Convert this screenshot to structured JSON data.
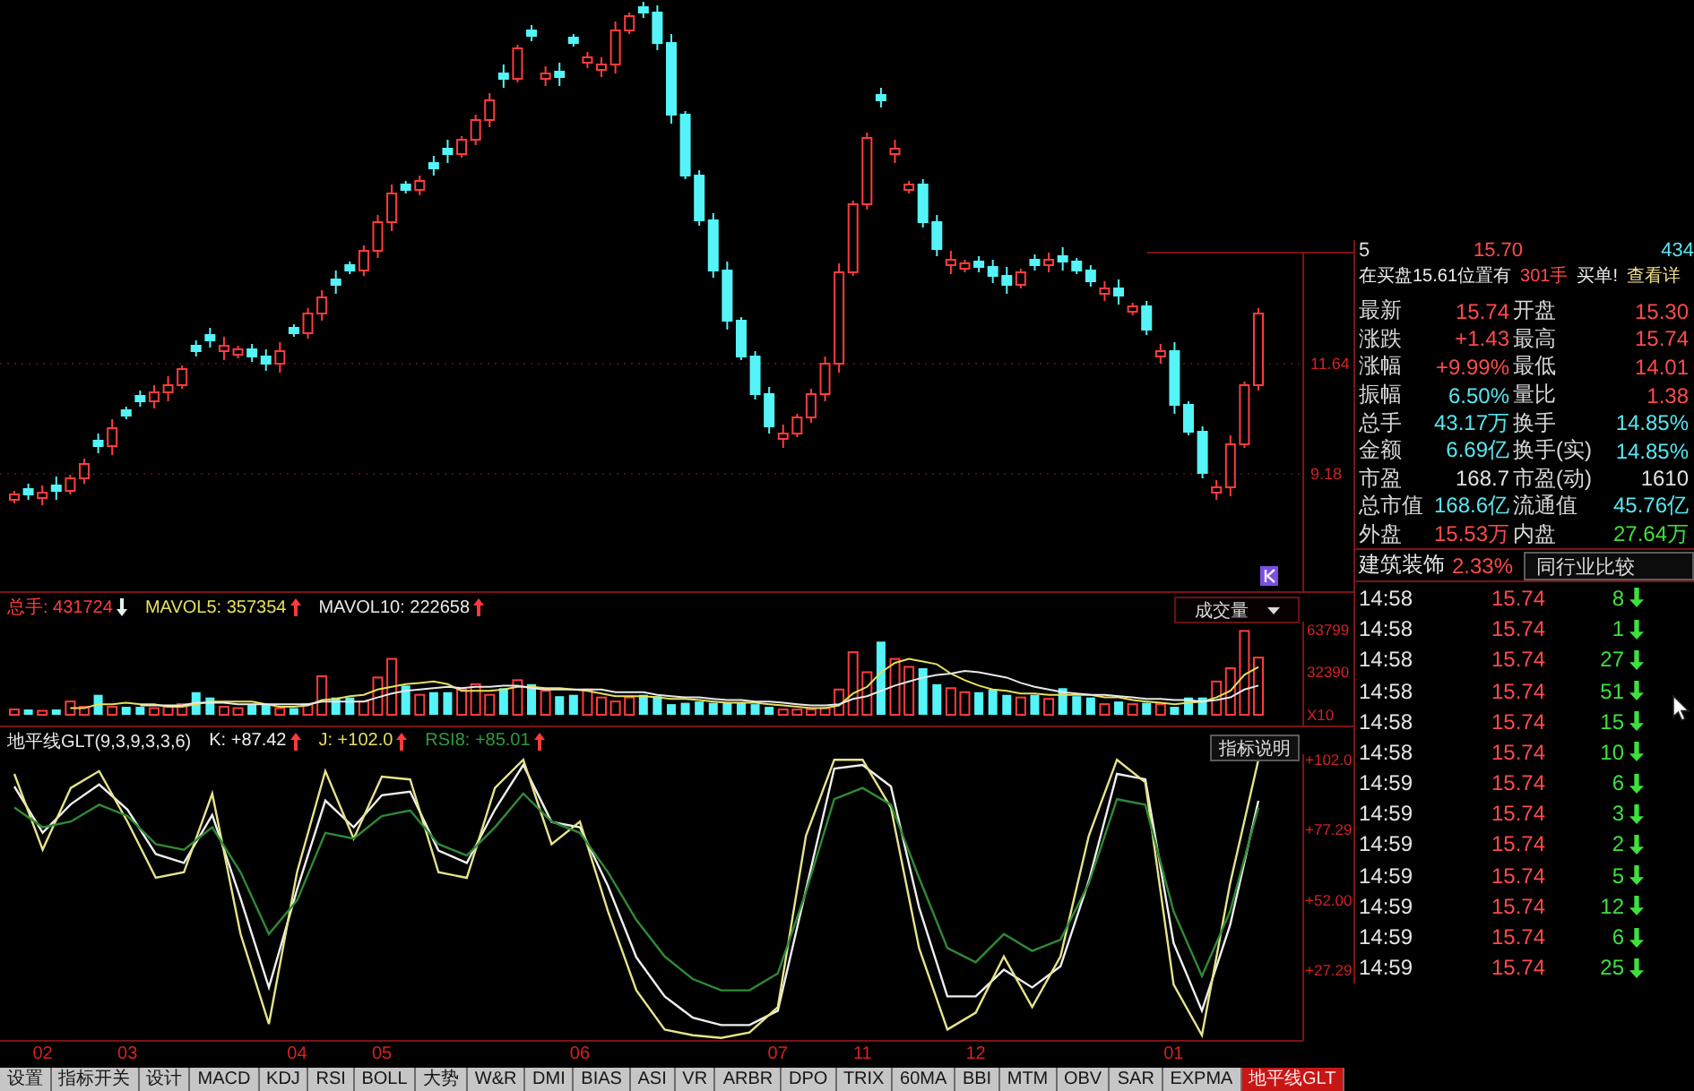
{
  "price_chart": {
    "chart_data": {
      "type": "candlestick",
      "ylim": [
        6.56,
        14.12
      ],
      "yticks": [
        {
          "value": 11.64,
          "label": "11.64"
        },
        {
          "value": 9.18,
          "label": "9.18"
        }
      ],
      "categories": [
        null,
        null,
        null,
        null,
        null,
        null,
        null,
        null,
        null,
        null,
        null,
        null,
        null,
        null,
        null,
        null,
        null,
        null,
        null,
        null,
        null,
        null,
        null,
        null,
        null,
        null,
        null,
        null,
        null,
        null,
        null,
        null,
        null,
        null,
        null,
        null,
        null,
        null,
        null,
        null,
        null,
        null,
        null,
        null,
        null,
        null,
        null,
        null,
        null,
        null,
        null,
        null,
        null,
        null,
        null,
        null,
        null,
        null,
        null,
        null,
        null,
        null,
        null,
        null,
        null,
        null,
        null,
        null,
        null,
        null,
        null,
        null,
        null,
        null,
        null,
        null,
        null,
        null,
        null,
        null,
        null,
        null,
        null,
        null,
        null,
        null,
        null,
        null,
        null,
        null
      ],
      "ohlc": [
        [
          8.6,
          8.8,
          8.52,
          8.72
        ],
        [
          8.84,
          8.96,
          8.6,
          8.72
        ],
        [
          8.64,
          8.92,
          8.48,
          8.76
        ],
        [
          8.92,
          9.12,
          8.6,
          8.8
        ],
        [
          8.8,
          9.16,
          8.72,
          9.08
        ],
        [
          9.08,
          9.52,
          8.96,
          9.4
        ],
        [
          9.92,
          10.08,
          9.64,
          9.8
        ],
        [
          9.8,
          10.4,
          9.6,
          10.2
        ],
        [
          10.6,
          10.68,
          10.4,
          10.48
        ],
        [
          10.92,
          11.04,
          10.68,
          10.8
        ],
        [
          10.8,
          11.16,
          10.64,
          11.0
        ],
        [
          11.0,
          11.36,
          10.8,
          11.16
        ],
        [
          11.16,
          11.6,
          11.08,
          11.52
        ],
        [
          12.04,
          12.16,
          11.8,
          11.92
        ],
        [
          12.28,
          12.44,
          12.0,
          12.16
        ],
        [
          11.92,
          12.24,
          11.72,
          12.04
        ],
        [
          11.84,
          12.04,
          11.76,
          11.96
        ],
        [
          11.96,
          12.08,
          11.68,
          11.8
        ],
        [
          11.8,
          11.96,
          11.48,
          11.64
        ],
        [
          11.64,
          12.12,
          11.44,
          11.92
        ],
        [
          12.44,
          12.52,
          12.24,
          12.32
        ],
        [
          12.32,
          12.88,
          12.2,
          12.76
        ],
        [
          12.76,
          13.28,
          12.6,
          13.12
        ],
        [
          13.52,
          13.72,
          13.2,
          13.4
        ],
        [
          13.84,
          13.92,
          13.64,
          13.72
        ],
        [
          13.72,
          14.28,
          13.6,
          14.16
        ],
        [
          14.16,
          14.96,
          14.0,
          14.8
        ],
        [
          14.8,
          15.64,
          14.6,
          15.44
        ],
        [
          15.64,
          15.72,
          15.44,
          15.52
        ],
        [
          15.52,
          15.84,
          15.4,
          15.72
        ],
        [
          16.12,
          16.28,
          15.84,
          16.0
        ],
        [
          16.44,
          16.64,
          16.12,
          16.32
        ],
        [
          16.32,
          16.72,
          16.24,
          16.64
        ],
        [
          16.64,
          17.2,
          16.52,
          17.08
        ],
        [
          17.08,
          17.68,
          16.92,
          17.52
        ],
        [
          18.12,
          18.32,
          17.8,
          18.0
        ],
        [
          18.0,
          18.76,
          17.92,
          18.68
        ],
        [
          19.08,
          19.2,
          18.84,
          18.96
        ],
        [
          18.0,
          18.28,
          17.84,
          18.12
        ],
        [
          18.16,
          18.36,
          17.84,
          18.04
        ],
        [
          18.92,
          19.0,
          18.72,
          18.8
        ],
        [
          18.36,
          18.6,
          18.24,
          18.48
        ],
        [
          18.2,
          18.48,
          18.04,
          18.32
        ],
        [
          18.32,
          19.28,
          18.12,
          19.08
        ],
        [
          19.08,
          19.48,
          19.0,
          19.4
        ],
        [
          19.6,
          19.72,
          19.36,
          19.48
        ],
        [
          19.48,
          19.64,
          18.64,
          18.8
        ],
        [
          18.8,
          19.0,
          17.0,
          17.2
        ],
        [
          17.2,
          17.28,
          15.76,
          15.84
        ],
        [
          15.84,
          15.96,
          14.72,
          14.84
        ],
        [
          14.84,
          15.0,
          13.56,
          13.72
        ],
        [
          13.72,
          13.92,
          12.4,
          12.6
        ],
        [
          12.6,
          12.68,
          11.72,
          11.8
        ],
        [
          11.8,
          11.92,
          10.84,
          10.96
        ],
        [
          10.96,
          11.12,
          10.08,
          10.24
        ],
        [
          9.96,
          10.28,
          9.76,
          10.08
        ],
        [
          10.08,
          10.52,
          10.0,
          10.44
        ],
        [
          10.44,
          11.08,
          10.32,
          10.96
        ],
        [
          10.96,
          11.8,
          10.8,
          11.64
        ],
        [
          11.64,
          13.88,
          11.44,
          13.68
        ],
        [
          13.68,
          15.28,
          13.6,
          15.2
        ],
        [
          15.2,
          16.8,
          15.08,
          16.68
        ],
        [
          17.64,
          17.8,
          17.36,
          17.52
        ],
        [
          16.32,
          16.64,
          16.12,
          16.44
        ],
        [
          15.52,
          15.72,
          15.44,
          15.64
        ],
        [
          15.64,
          15.76,
          14.68,
          14.8
        ],
        [
          14.8,
          14.96,
          14.04,
          14.2
        ],
        [
          13.84,
          14.16,
          13.64,
          13.96
        ],
        [
          13.76,
          13.96,
          13.68,
          13.88
        ],
        [
          13.92,
          14.04,
          13.68,
          13.8
        ],
        [
          13.8,
          13.96,
          13.44,
          13.6
        ],
        [
          13.6,
          13.8,
          13.2,
          13.4
        ],
        [
          13.4,
          13.76,
          13.32,
          13.68
        ],
        [
          13.96,
          14.08,
          13.72,
          13.84
        ],
        [
          13.84,
          14.12,
          13.68,
          13.96
        ],
        [
          14.04,
          14.24,
          13.72,
          13.92
        ],
        [
          13.92,
          14.0,
          13.64,
          13.72
        ],
        [
          13.72,
          13.84,
          13.36,
          13.48
        ],
        [
          13.2,
          13.48,
          13.04,
          13.32
        ],
        [
          13.32,
          13.52,
          12.96,
          13.16
        ],
        [
          12.8,
          13.0,
          12.72,
          12.92
        ],
        [
          12.92,
          13.04,
          12.28,
          12.4
        ],
        [
          11.8,
          12.08,
          11.64,
          11.92
        ],
        [
          11.92,
          12.12,
          10.52,
          10.72
        ],
        [
          10.72,
          10.8,
          10.04,
          10.12
        ],
        [
          10.12,
          10.24,
          9.08,
          9.2
        ],
        [
          8.76,
          9.04,
          8.6,
          8.88
        ],
        [
          8.88,
          10.04,
          8.68,
          9.84
        ],
        [
          9.84,
          11.24,
          9.76,
          11.16
        ],
        [
          11.16,
          12.88,
          11.04,
          12.76
        ]
      ]
    }
  },
  "volume_pane": {
    "header": [
      {
        "text": "总手: 431724",
        "color": "#ff3c3c",
        "rising": false
      },
      {
        "text": "MAVOL5: 357354",
        "color": "#e6e05a",
        "rising": true
      },
      {
        "text": "MAVOL10: 222658",
        "color": "#e8e8e8",
        "rising": true
      }
    ],
    "selector": "成交量",
    "chart_data": {
      "type": "bar",
      "stacked": true,
      "ylim": [
        0,
        70000
      ],
      "yticks": [
        {
          "value": 0,
          "label": "X10"
        },
        {
          "value": 32390,
          "label": "32390"
        },
        {
          "value": 63799,
          "label": "63799"
        }
      ],
      "categories": [
        null,
        null,
        null,
        null,
        null,
        null,
        null,
        null,
        null,
        null,
        null,
        null,
        null,
        null,
        null,
        null,
        null,
        null,
        null,
        null,
        null,
        null,
        null,
        null,
        null,
        null,
        null,
        null,
        null,
        null,
        null,
        null,
        null,
        null,
        null,
        null,
        null,
        null,
        null,
        null,
        null,
        null,
        null,
        null,
        null,
        null,
        null,
        null,
        null,
        null,
        null,
        null,
        null,
        null,
        null,
        null,
        null,
        null,
        null,
        null,
        null,
        null,
        null,
        null,
        null,
        null,
        null,
        null,
        null,
        null,
        null,
        null,
        null,
        null,
        null,
        null,
        null,
        null,
        null,
        null,
        null,
        null,
        null,
        null,
        null,
        null,
        null,
        null,
        null,
        null
      ],
      "series": [
        {
          "color": "#ff3c3c",
          "values": [
            4000,
            null,
            3000,
            null,
            10000,
            6000,
            null,
            6000,
            null,
            null,
            5000,
            6000,
            8000,
            null,
            null,
            6000,
            5000,
            null,
            null,
            5000,
            null,
            8000,
            29000,
            null,
            null,
            10000,
            28000,
            42000,
            null,
            15000,
            null,
            null,
            19000,
            23000,
            15000,
            null,
            26000,
            null,
            18000,
            null,
            null,
            19000,
            13000,
            10000,
            13000,
            null,
            null,
            null,
            null,
            null,
            null,
            null,
            null,
            null,
            null,
            4000,
            4000,
            4000,
            5000,
            19000,
            47000,
            32000,
            null,
            42000,
            36000,
            null,
            null,
            20000,
            17000,
            null,
            null,
            null,
            13000,
            null,
            12000,
            null,
            null,
            null,
            8000,
            null,
            8000,
            null,
            8000,
            null,
            null,
            null,
            25000,
            35000,
            63000,
            43000
          ]
        },
        {
          "color": "#54f4f8",
          "values": [
            null,
            4000,
            null,
            4000,
            null,
            null,
            15000,
            null,
            6000,
            6000,
            null,
            null,
            null,
            17000,
            13000,
            null,
            null,
            8000,
            8000,
            null,
            5000,
            null,
            null,
            13000,
            13000,
            null,
            null,
            null,
            22000,
            null,
            17000,
            17000,
            null,
            null,
            null,
            20000,
            null,
            23000,
            null,
            14000,
            15000,
            null,
            null,
            null,
            null,
            15000,
            14000,
            8000,
            9000,
            10000,
            9000,
            9000,
            9000,
            8000,
            6000,
            null,
            null,
            null,
            null,
            null,
            null,
            null,
            55000,
            null,
            null,
            35000,
            23000,
            null,
            null,
            17000,
            19000,
            15000,
            null,
            15000,
            null,
            20000,
            14000,
            13000,
            null,
            10000,
            null,
            9000,
            null,
            6000,
            13000,
            13000,
            null,
            null,
            null,
            null
          ]
        },
        {
          "type": "line",
          "color": "#e6e05a",
          "values": [
            null,
            null,
            null,
            null,
            5000,
            5000,
            8000,
            8000,
            9000,
            8000,
            8000,
            6000,
            6000,
            8000,
            10000,
            10000,
            10000,
            10000,
            8000,
            6000,
            6000,
            7000,
            11000,
            12000,
            14000,
            15000,
            19000,
            21000,
            23000,
            24000,
            25000,
            23000,
            18000,
            18000,
            18000,
            19000,
            21000,
            21000,
            20000,
            20000,
            19000,
            18000,
            16000,
            14000,
            14000,
            14000,
            13000,
            12000,
            12000,
            11000,
            10000,
            9000,
            9000,
            9000,
            8000,
            7000,
            6000,
            5000,
            5000,
            7000,
            16000,
            21000,
            32000,
            39000,
            42000,
            40000,
            38000,
            31000,
            26000,
            22000,
            19000,
            18000,
            16000,
            16000,
            15000,
            15000,
            15000,
            15000,
            13000,
            13000,
            11000,
            10000,
            9000,
            8000,
            9000,
            10000,
            13000,
            18000,
            30000,
            36000
          ]
        },
        {
          "type": "line",
          "color": "#e8e8e8",
          "values": [
            null,
            null,
            null,
            null,
            null,
            null,
            null,
            null,
            null,
            7000,
            7000,
            7000,
            7000,
            9000,
            9000,
            9000,
            8000,
            8000,
            8000,
            8000,
            8000,
            8000,
            10000,
            10000,
            10000,
            10000,
            13000,
            16000,
            18000,
            19000,
            20000,
            21000,
            20000,
            21000,
            21000,
            22000,
            22000,
            20000,
            19000,
            19000,
            19000,
            19000,
            19000,
            17000,
            17000,
            17000,
            15000,
            14000,
            13000,
            13000,
            12000,
            11000,
            11000,
            10000,
            10000,
            9000,
            8000,
            7000,
            7000,
            8000,
            12000,
            14000,
            18000,
            22000,
            25000,
            28000,
            30000,
            31000,
            33000,
            32000,
            30000,
            28000,
            24000,
            21000,
            19000,
            17000,
            16000,
            15000,
            15000,
            14000,
            13000,
            12000,
            12000,
            11000,
            11000,
            10000,
            11000,
            13000,
            19000,
            22000
          ]
        }
      ]
    }
  },
  "indicator_pane": {
    "title": "地平线GLT(9,3,9,3,3,6)",
    "header": [
      {
        "text": "K: +87.42",
        "color": "#f0f0f0",
        "rising": true
      },
      {
        "text": "J: +102.0",
        "color": "#e6e05a",
        "rising": true
      },
      {
        "text": "RSI8: +85.01",
        "color": "#2f9a3a",
        "rising": true
      }
    ],
    "button": "指标说明",
    "chart_data": {
      "type": "line",
      "ylim": [
        2,
        104
      ],
      "yticks": [
        {
          "value": 27.29,
          "label": "+27.29"
        },
        {
          "value": 52,
          "label": "+52.00"
        },
        {
          "value": 77.29,
          "label": "+77.29"
        },
        {
          "value": 102,
          "label": "+102.0"
        }
      ],
      "categories": [
        null,
        "02",
        null,
        null,
        "03",
        null,
        null,
        null,
        null,
        null,
        "04",
        null,
        null,
        "05",
        null,
        null,
        null,
        null,
        null,
        null,
        "06",
        null,
        null,
        null,
        null,
        null,
        null,
        "07",
        null,
        null,
        "11",
        null,
        null,
        null,
        "12",
        null,
        null,
        null,
        null,
        null,
        null,
        "01",
        null,
        null,
        null
      ],
      "series": [
        {
          "color": "#f0f0f0",
          "values": [
            92.5,
            76.1,
            86.2,
            93.2,
            84.3,
            68.5,
            65.3,
            82.4,
            52.6,
            21.0,
            55.8,
            87.5,
            78.0,
            89.4,
            90.7,
            69.7,
            65.3,
            84.3,
            100.2,
            79.9,
            78.0,
            57.1,
            31.7,
            17.8,
            10.2,
            7.6,
            7.6,
            12.7,
            55.8,
            98.9,
            100.2,
            92.5,
            49.5,
            17.8,
            17.8,
            27.3,
            21.0,
            28.5,
            59.0,
            97.0,
            95.1,
            36.8,
            12.7,
            43.1,
            87.4
          ]
        },
        {
          "color": "#e6e48a",
          "values": [
            97,
            70,
            92,
            98,
            80,
            60,
            62,
            90,
            40,
            8,
            62,
            98,
            74,
            96,
            95,
            62,
            60,
            92,
            102,
            72,
            80,
            48,
            20,
            6,
            4,
            3,
            5,
            14,
            75,
            102,
            102,
            85,
            35,
            6,
            12,
            32,
            14,
            32,
            75,
            102,
            94,
            22,
            4,
            58,
            102
          ]
        },
        {
          "color": "#2f8a36",
          "values": [
            85,
            78,
            80,
            86,
            82,
            72,
            70,
            78,
            62,
            40,
            52,
            76,
            74,
            82,
            84,
            72,
            68,
            78,
            90,
            80,
            76,
            62,
            45,
            32,
            24,
            20,
            20,
            26,
            55,
            88,
            92,
            86,
            60,
            35,
            30,
            40,
            34,
            38,
            58,
            88,
            86,
            48,
            25,
            48,
            85
          ]
        }
      ]
    }
  },
  "quote_panel": {
    "order_row": [
      {
        "text": "5",
        "color": "#e2e2e2"
      },
      {
        "text": "15.70",
        "color": "#ff4a4a"
      },
      {
        "text": "434",
        "color": "#58e6f0"
      }
    ],
    "alert": {
      "text": "在买盘15.61位置有",
      "volume": "301手",
      "action": "买单!",
      "link": "查看详"
    },
    "quotes": [
      {
        "label": "最新",
        "value": "15.74",
        "color": "#ff4a4a"
      },
      {
        "label": "开盘",
        "value": "15.30",
        "color": "#ff4a4a"
      },
      {
        "label": "涨跌",
        "value": "+1.43",
        "color": "#ff4a4a"
      },
      {
        "label": "最高",
        "value": "15.74",
        "color": "#ff4a4a"
      },
      {
        "label": "涨幅",
        "value": "+9.99%",
        "color": "#ff4a4a"
      },
      {
        "label": "最低",
        "value": "14.01",
        "color": "#ff4a4a"
      },
      {
        "label": "振幅",
        "value": "6.50%",
        "color": "#58e6f0"
      },
      {
        "label": "量比",
        "value": "1.38",
        "color": "#ff4a4a"
      },
      {
        "label": "总手",
        "value": "43.17万",
        "color": "#58e6f0"
      },
      {
        "label": "换手",
        "value": "14.85%",
        "color": "#58e6f0"
      },
      {
        "label": "金额",
        "value": "6.69亿",
        "color": "#58e6f0"
      },
      {
        "label": "换手(实)",
        "value": "14.85%",
        "color": "#58e6f0"
      },
      {
        "label": "市盈",
        "value": "168.7",
        "color": "#e2e2e2"
      },
      {
        "label": "市盈(动)",
        "value": "1610",
        "color": "#e2e2e2"
      },
      {
        "label": "总市值",
        "value": "168.6亿",
        "color": "#58e6f0"
      },
      {
        "label": "流通值",
        "value": "45.76亿",
        "color": "#58e6f0"
      },
      {
        "label": "外盘",
        "value": "15.53万",
        "color": "#ff4a4a"
      },
      {
        "label": "内盘",
        "value": "27.64万",
        "color": "#3ee03e"
      }
    ],
    "sector": {
      "name": "建筑装饰",
      "change": "2.33%",
      "button": "同行业比较"
    },
    "trades": [
      {
        "time": "14:58",
        "price": "15.74",
        "volume": "8",
        "rising": false
      },
      {
        "time": "14:58",
        "price": "15.74",
        "volume": "1",
        "rising": false
      },
      {
        "time": "14:58",
        "price": "15.74",
        "volume": "27",
        "rising": false
      },
      {
        "time": "14:58",
        "price": "15.74",
        "volume": "51",
        "rising": false
      },
      {
        "time": "14:58",
        "price": "15.74",
        "volume": "15",
        "rising": false
      },
      {
        "time": "14:58",
        "price": "15.74",
        "volume": "10",
        "rising": false
      },
      {
        "time": "14:59",
        "price": "15.74",
        "volume": "6",
        "rising": false
      },
      {
        "time": "14:59",
        "price": "15.74",
        "volume": "3",
        "rising": false
      },
      {
        "time": "14:59",
        "price": "15.74",
        "volume": "2",
        "rising": false
      },
      {
        "time": "14:59",
        "price": "15.74",
        "volume": "5",
        "rising": false
      },
      {
        "time": "14:59",
        "price": "15.74",
        "volume": "12",
        "rising": false
      },
      {
        "time": "14:59",
        "price": "15.74",
        "volume": "6",
        "rising": false
      },
      {
        "time": "14:59",
        "price": "15.74",
        "volume": "25",
        "rising": false
      }
    ]
  },
  "tabs": [
    {
      "label": "设置",
      "selected": false
    },
    {
      "label": "指标开关",
      "selected": false
    },
    {
      "label": "设计",
      "selected": false
    },
    {
      "label": "MACD",
      "selected": false
    },
    {
      "label": "KDJ",
      "selected": false
    },
    {
      "label": "RSI",
      "selected": false
    },
    {
      "label": "BOLL",
      "selected": false
    },
    {
      "label": "大势",
      "selected": false
    },
    {
      "label": "W&R",
      "selected": false
    },
    {
      "label": "DMI",
      "selected": false
    },
    {
      "label": "BIAS",
      "selected": false
    },
    {
      "label": "ASI",
      "selected": false
    },
    {
      "label": "VR",
      "selected": false
    },
    {
      "label": "ARBR",
      "selected": false
    },
    {
      "label": "DPO",
      "selected": false
    },
    {
      "label": "TRIX",
      "selected": false
    },
    {
      "label": "60MA",
      "selected": false
    },
    {
      "label": "BBI",
      "selected": false
    },
    {
      "label": "MTM",
      "selected": false
    },
    {
      "label": "OBV",
      "selected": false
    },
    {
      "label": "SAR",
      "selected": false
    },
    {
      "label": "EXPMA",
      "selected": false
    },
    {
      "label": "地平线GLT",
      "selected": true
    }
  ]
}
